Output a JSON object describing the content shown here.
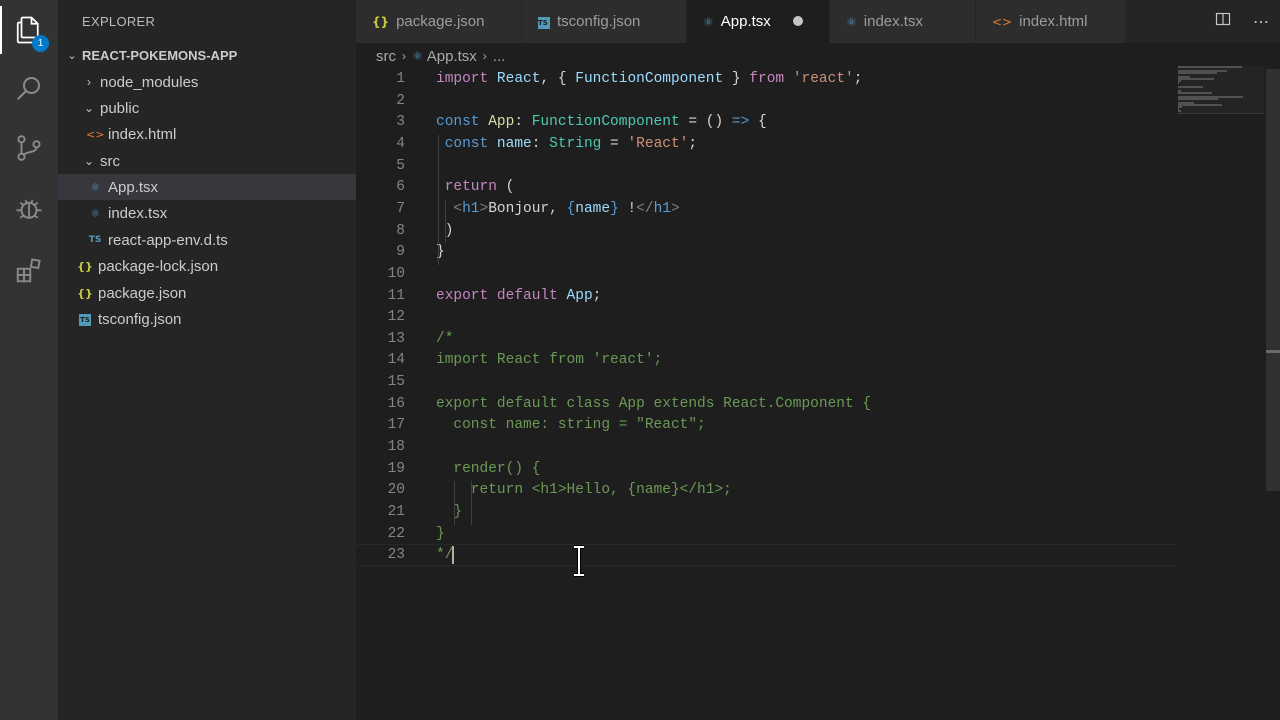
{
  "activity_bar": {
    "items": [
      {
        "name": "explorer",
        "icon": "files-icon",
        "badge": "1"
      },
      {
        "name": "search",
        "icon": "search-icon"
      },
      {
        "name": "source-control",
        "icon": "source-control-icon"
      },
      {
        "name": "debug",
        "icon": "debug-icon"
      },
      {
        "name": "extensions",
        "icon": "extensions-icon"
      }
    ]
  },
  "sidebar": {
    "title": "EXPLORER",
    "project": "REACT-POKEMONS-APP",
    "tree": [
      {
        "label": "node_modules",
        "kind": "folder",
        "expanded": false,
        "depth": 1
      },
      {
        "label": "public",
        "kind": "folder",
        "expanded": true,
        "depth": 1
      },
      {
        "label": "index.html",
        "kind": "html",
        "depth": 2
      },
      {
        "label": "src",
        "kind": "folder",
        "expanded": true,
        "depth": 1
      },
      {
        "label": "App.tsx",
        "kind": "react",
        "depth": 2,
        "selected": true
      },
      {
        "label": "index.tsx",
        "kind": "react",
        "depth": 2
      },
      {
        "label": "react-app-env.d.ts",
        "kind": "ts",
        "depth": 2,
        "icon_text": "TS"
      },
      {
        "label": "package-lock.json",
        "kind": "json",
        "depth": 1,
        "icon_text": "{}"
      },
      {
        "label": "package.json",
        "kind": "json",
        "depth": 1,
        "icon_text": "{}"
      },
      {
        "label": "tsconfig.json",
        "kind": "tsconfig",
        "depth": 1,
        "icon_text": "TS"
      }
    ]
  },
  "tabs": [
    {
      "label": "package.json",
      "icon_text": "{}",
      "kind": "json"
    },
    {
      "label": "tsconfig.json",
      "icon_text": "TS",
      "kind": "tsconfig"
    },
    {
      "label": "App.tsx",
      "icon_text": "⚛",
      "kind": "react",
      "active": true,
      "dirty": true
    },
    {
      "label": "index.tsx",
      "icon_text": "⚛",
      "kind": "react"
    },
    {
      "label": "index.html",
      "icon_text": "<>",
      "kind": "html"
    }
  ],
  "tab_actions": {
    "split": "split-editor-icon",
    "more": "⋯"
  },
  "breadcrumb": {
    "items": [
      "src",
      "App.tsx",
      "..."
    ]
  },
  "editor": {
    "line_numbers": [
      "1",
      "2",
      "3",
      "4",
      "5",
      "6",
      "7",
      "8",
      "9",
      "10",
      "11",
      "12",
      "13",
      "14",
      "15",
      "16",
      "17",
      "18",
      "19",
      "20",
      "21",
      "22",
      "23"
    ],
    "lines": [
      [
        {
          "c": "k",
          "t": "import "
        },
        {
          "c": "v",
          "t": "React"
        },
        {
          "c": "p",
          "t": ", { "
        },
        {
          "c": "v",
          "t": "FunctionComponent"
        },
        {
          "c": "p",
          "t": " } "
        },
        {
          "c": "k",
          "t": "from "
        },
        {
          "c": "s",
          "t": "'react'"
        },
        {
          "c": "p",
          "t": ";"
        }
      ],
      [],
      [
        {
          "c": "kb",
          "t": "const "
        },
        {
          "c": "f",
          "t": "App"
        },
        {
          "c": "p",
          "t": ": "
        },
        {
          "c": "t",
          "t": "FunctionComponent"
        },
        {
          "c": "p",
          "t": " = () "
        },
        {
          "c": "kb",
          "t": "=>"
        },
        {
          "c": "p",
          "t": " {"
        }
      ],
      [
        {
          "c": "p",
          "t": " "
        },
        {
          "c": "kb",
          "t": "const "
        },
        {
          "c": "v",
          "t": "name"
        },
        {
          "c": "p",
          "t": ": "
        },
        {
          "c": "t",
          "t": "String"
        },
        {
          "c": "p",
          "t": " = "
        },
        {
          "c": "s",
          "t": "'React'"
        },
        {
          "c": "p",
          "t": ";"
        }
      ],
      [],
      [
        {
          "c": "p",
          "t": " "
        },
        {
          "c": "k",
          "t": "return"
        },
        {
          "c": "p",
          "t": " ("
        }
      ],
      [
        {
          "c": "p",
          "t": "  "
        },
        {
          "c": "tb",
          "t": "<"
        },
        {
          "c": "tag",
          "t": "h1"
        },
        {
          "c": "tb",
          "t": ">"
        },
        {
          "c": "p",
          "t": "Bonjour, "
        },
        {
          "c": "kb",
          "t": "{"
        },
        {
          "c": "v",
          "t": "name"
        },
        {
          "c": "kb",
          "t": "}"
        },
        {
          "c": "p",
          "t": " !"
        },
        {
          "c": "tb",
          "t": "</"
        },
        {
          "c": "tag",
          "t": "h1"
        },
        {
          "c": "tb",
          "t": ">"
        }
      ],
      [
        {
          "c": "p",
          "t": " )"
        }
      ],
      [
        {
          "c": "p",
          "t": "}"
        }
      ],
      [],
      [
        {
          "c": "k",
          "t": "export "
        },
        {
          "c": "k",
          "t": "default "
        },
        {
          "c": "v",
          "t": "App"
        },
        {
          "c": "p",
          "t": ";"
        }
      ],
      [],
      [
        {
          "c": "c",
          "t": "/*"
        }
      ],
      [
        {
          "c": "c",
          "t": "import React from 'react';"
        }
      ],
      [],
      [
        {
          "c": "c",
          "t": "export default class App extends React.Component {"
        }
      ],
      [
        {
          "c": "c",
          "t": "  const name: string = \"React\";"
        }
      ],
      [],
      [
        {
          "c": "c",
          "t": "  render() {"
        }
      ],
      [
        {
          "c": "c",
          "t": "    return <h1>Hello, {name}</h1>;"
        }
      ],
      [
        {
          "c": "c",
          "t": "  }"
        }
      ],
      [
        {
          "c": "c",
          "t": "}"
        }
      ],
      [
        {
          "c": "c",
          "t": "*/"
        }
      ]
    ],
    "current_line": "23"
  },
  "colors": {
    "activity_bar": "#333333",
    "sidebar": "#252526",
    "editor": "#1e1e1e",
    "accent": "#007acc",
    "comment": "#6a9955",
    "keyword": "#c586c0",
    "string": "#ce9178",
    "type": "#4ec9b0"
  }
}
